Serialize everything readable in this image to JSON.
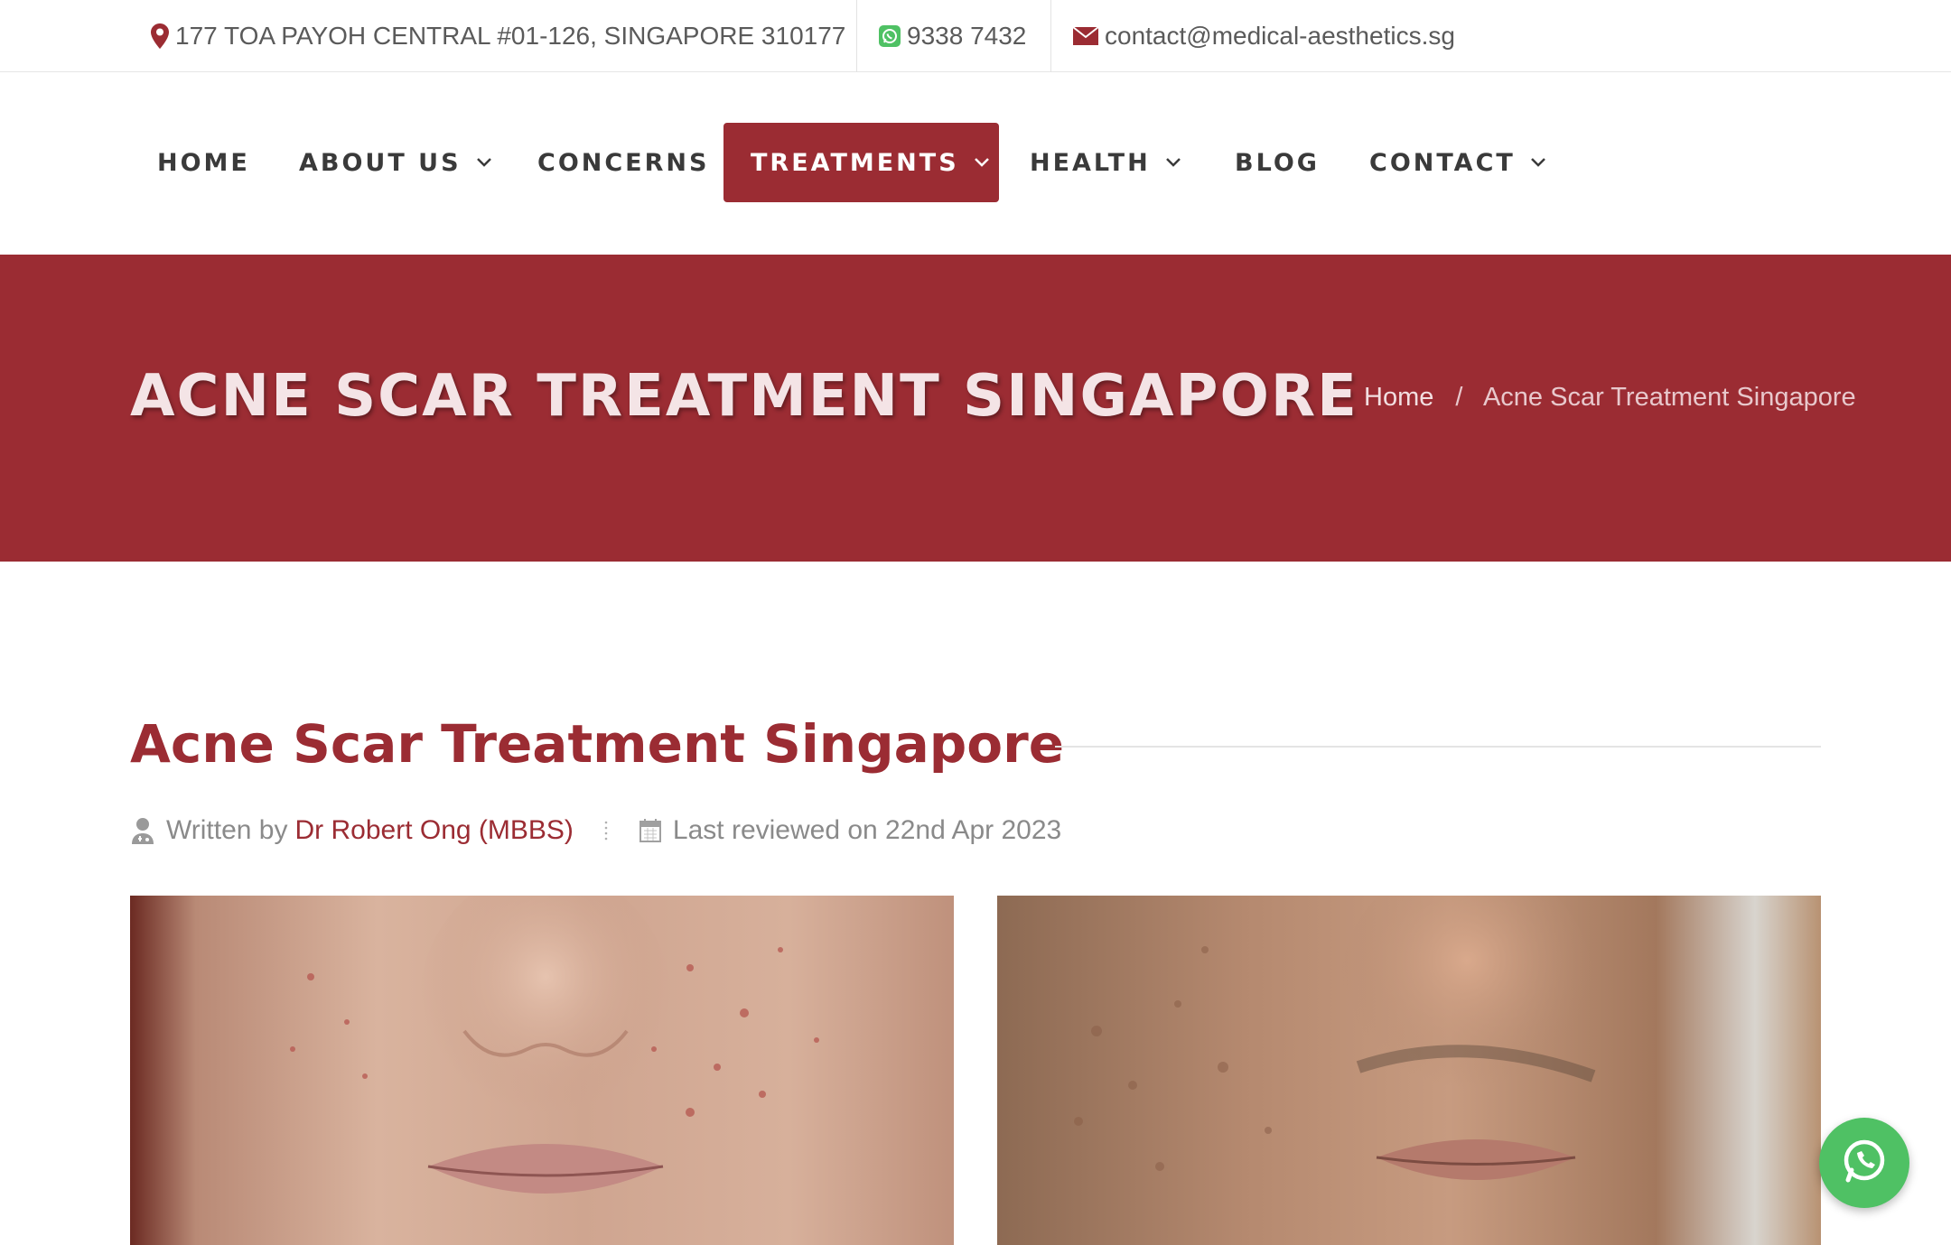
{
  "topbar": {
    "address": "177 TOA PAYOH CENTRAL #01-126, SINGAPORE 310177",
    "phone": "9338 7432",
    "email": "contact@medical-aesthetics.sg"
  },
  "nav": {
    "items": [
      {
        "label": "HOME",
        "has_dropdown": false
      },
      {
        "label": "ABOUT US",
        "has_dropdown": true
      },
      {
        "label": "CONCERNS",
        "has_dropdown": false
      },
      {
        "label": "TREATMENTS",
        "has_dropdown": true,
        "active": true
      },
      {
        "label": "HEALTH",
        "has_dropdown": true
      },
      {
        "label": "BLOG",
        "has_dropdown": false
      },
      {
        "label": "CONTACT",
        "has_dropdown": true
      }
    ]
  },
  "hero": {
    "title": "ACNE SCAR TREATMENT SINGAPORE",
    "breadcrumb": {
      "home": "Home",
      "separator": "/",
      "current": "Acne Scar Treatment Singapore"
    }
  },
  "article": {
    "title": "Acne Scar Treatment Singapore",
    "written_by_label": "Written by",
    "author": "Dr Robert Ong (MBBS)",
    "reviewed": "Last reviewed on 22nd Apr 2023"
  },
  "icons": {
    "address": "map-pin-icon",
    "phone": "whatsapp-icon",
    "email": "envelope-icon",
    "author": "doctor-icon",
    "date": "calendar-icon",
    "dropdown": "chevron-down-icon",
    "float": "whatsapp-icon"
  },
  "colors": {
    "brand": "#9b2c33",
    "whatsapp": "#4fc164",
    "text": "#555555"
  }
}
